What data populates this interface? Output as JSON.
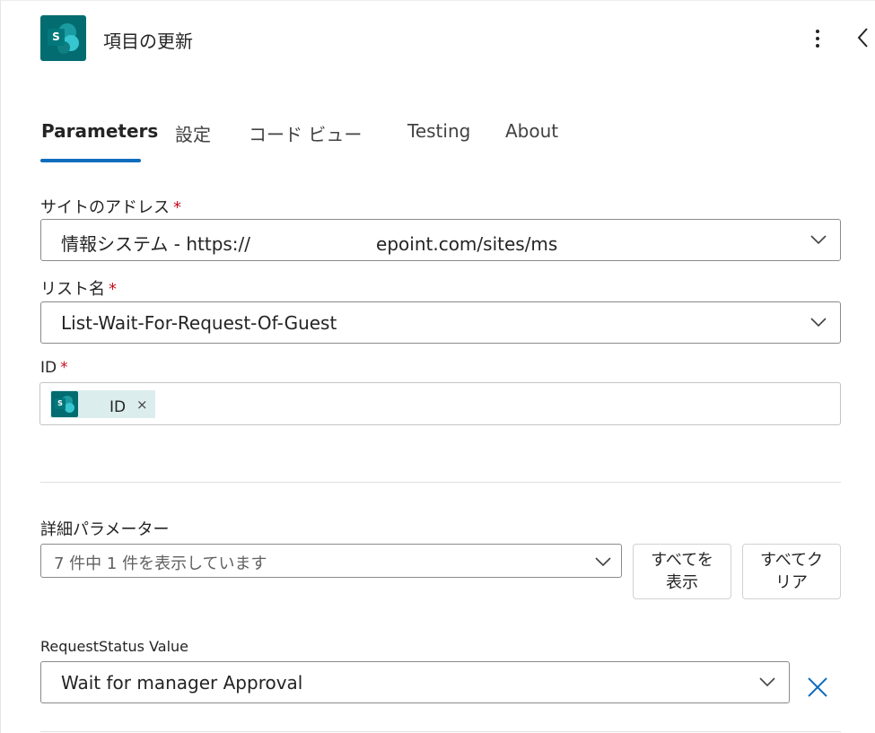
{
  "header": {
    "app_icon": "sharepoint-icon",
    "logo_letter": "S",
    "title": "項目の更新",
    "more_icon": "more-vertical-icon",
    "collapse_icon": "chevron-left-icon"
  },
  "tabs": [
    {
      "label": "Parameters",
      "active": true
    },
    {
      "label": "設定",
      "active": false
    },
    {
      "label": "コード ビュー",
      "active": false
    },
    {
      "label": "Testing",
      "active": false
    },
    {
      "label": "About",
      "active": false
    }
  ],
  "fields": {
    "site_address": {
      "label": "サイトのアドレス",
      "required_mark": "*",
      "value": "情報システム - https://",
      "value_tail": "epoint.com/sites/ms"
    },
    "list_name": {
      "label": "リスト名",
      "required_mark": "*",
      "value": "List-Wait-For-Request-Of-Guest"
    },
    "id": {
      "label": "ID",
      "required_mark": "*",
      "token_label": "ID",
      "token_remove": "×",
      "token_logo_letter": "S"
    }
  },
  "advanced": {
    "label": "詳細パラメーター",
    "summary": "7 件中 1 件を表示しています",
    "show_all_line1": "すべてを",
    "show_all_line2": "表示",
    "clear_all_line1": "すべてク",
    "clear_all_line2": "リア"
  },
  "request_status": {
    "label": "RequestStatus Value",
    "value": "Wait for manager Approval",
    "remove_icon": "close-icon"
  },
  "colors": {
    "accent": "#0f6cbd",
    "sharepoint_teal": "#036c70",
    "required": "#c50f1f"
  }
}
